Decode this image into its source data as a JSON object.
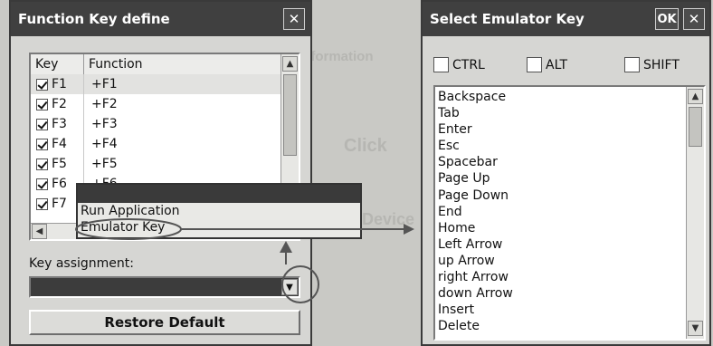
{
  "function_dialog": {
    "title": "Function Key define",
    "close_label": "✕",
    "columns": [
      "Key",
      "Function"
    ],
    "rows": [
      {
        "key": "F1",
        "function": "+F1",
        "checked": true
      },
      {
        "key": "F2",
        "function": "+F2",
        "checked": true
      },
      {
        "key": "F3",
        "function": "+F3",
        "checked": true
      },
      {
        "key": "F4",
        "function": "+F4",
        "checked": true
      },
      {
        "key": "F5",
        "function": "+F5",
        "checked": true
      },
      {
        "key": "F6",
        "function": "+F6",
        "checked": true
      },
      {
        "key": "F7",
        "function": "",
        "checked": true
      }
    ],
    "key_assignment_label": "Key assignment:",
    "key_assignment_value": "",
    "restore_label": "Restore Default"
  },
  "dropdown_popup": {
    "items": [
      "Run Application",
      "Emulator Key"
    ],
    "selected": "Emulator Key"
  },
  "emulator_dialog": {
    "title": "Select Emulator Key",
    "ok_label": "OK",
    "close_label": "✕",
    "modifiers": [
      {
        "label": "CTRL",
        "checked": false
      },
      {
        "label": "ALT",
        "checked": false
      },
      {
        "label": "SHIFT",
        "checked": false
      }
    ],
    "keys": [
      "Backspace",
      "Tab",
      "Enter",
      "Esc",
      "Spacebar",
      "Page Up",
      "Page Down",
      "End",
      "Home",
      "Left Arrow",
      "up Arrow",
      "right Arrow",
      "down Arrow",
      "Insert",
      "Delete"
    ]
  },
  "background_text": [
    "Information",
    "Click",
    "Device"
  ],
  "colors": {
    "titlebar": "#404040",
    "dialog": "#d6d6d3",
    "annotation": "#555555"
  }
}
